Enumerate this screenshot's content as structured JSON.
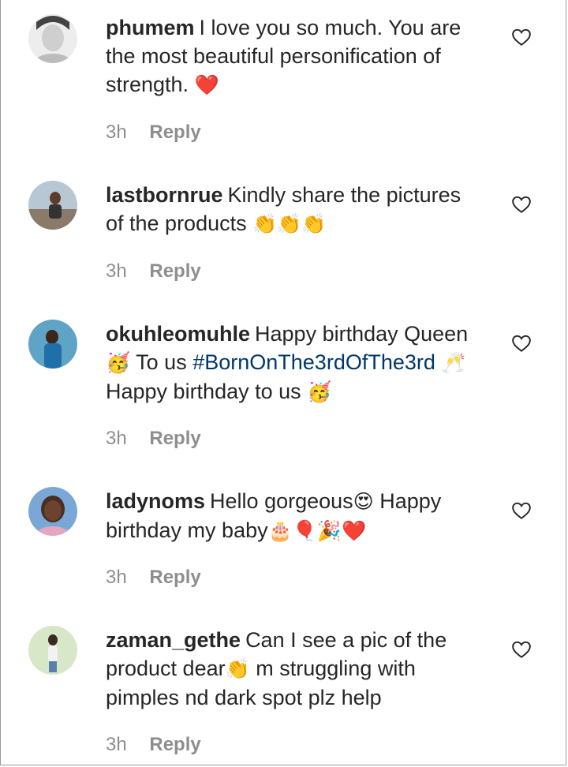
{
  "comments": [
    {
      "username": "phumem",
      "text_before": "I love you so much. You are the most beautiful personification of strength.",
      "emojis": "❤️",
      "time": "3h",
      "reply_label": "Reply"
    },
    {
      "username": "lastbornrue",
      "text_before": "Kindly share the pictures of the products",
      "emojis": "👏👏👏",
      "time": "3h",
      "reply_label": "Reply"
    },
    {
      "username": "okuhleomuhle",
      "text_before": "Happy birthday Queen",
      "emoji1": "🥳",
      "text_mid": "To us",
      "hashtag": "#BornOnThe3rdOfThe3rd",
      "emoji2": "🥂",
      "text_after": "Happy birthday to us",
      "emoji3": "🥳",
      "time": "3h",
      "reply_label": "Reply"
    },
    {
      "username": "ladynoms",
      "text_before": "Hello gorgeous",
      "emoji1": "😍",
      "text_mid": "Happy birthday my baby",
      "emojis": "🎂🎈🎉❤️",
      "time": "3h",
      "reply_label": "Reply"
    },
    {
      "username": "zaman_gethe",
      "text_before": "Can I see a pic of the product dear",
      "emoji1": "👏",
      "text_after": "m struggling with pimples nd dark spot plz help",
      "time": "3h",
      "reply_label": "Reply"
    }
  ],
  "icons": {
    "heart": "heart-outline-icon",
    "avatar": "user-avatar"
  },
  "colors": {
    "text": "#262626",
    "muted": "#8e8e8e",
    "hashtag": "#00376b",
    "heart_red": "#e0201f"
  }
}
